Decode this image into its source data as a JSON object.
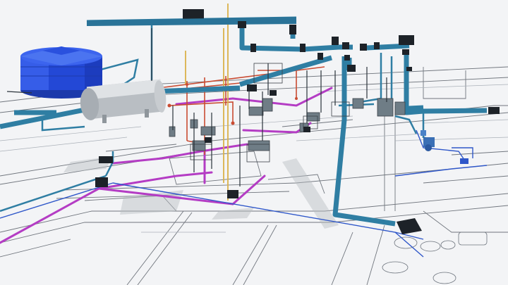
{
  "scene": {
    "description_visible_text": "",
    "colors": {
      "background": "#f3f4f6",
      "floor_lines": "#4a4f57",
      "floor_lines_light": "#9aa0a8",
      "cold_water_pipe": "#2f7ea3",
      "cold_water_pipe_dark": "#1f5d7c",
      "hot_water_pipe": "#c94b32",
      "drain_pipe": "#b43cc4",
      "vent_pipe": "#d9b24a",
      "blue_line": "#2f57c9",
      "fitting": "#1d2228",
      "tank": "#2348d6",
      "tank_light": "#4b74f0",
      "heater": "#b9bec3",
      "heater_light": "#e4e6e8",
      "fixture": "#6f7d86",
      "pump": "#3a6fb5"
    },
    "equipment": [
      {
        "name": "water-tank",
        "type": "cylindrical tank"
      },
      {
        "name": "water-heater",
        "type": "horizontal cylinder boiler"
      },
      {
        "name": "pump",
        "type": "pump unit"
      },
      {
        "name": "floor-drain-boxes",
        "type": "drain boxes"
      },
      {
        "name": "sink-fixtures",
        "type": "sink fixtures"
      }
    ]
  }
}
